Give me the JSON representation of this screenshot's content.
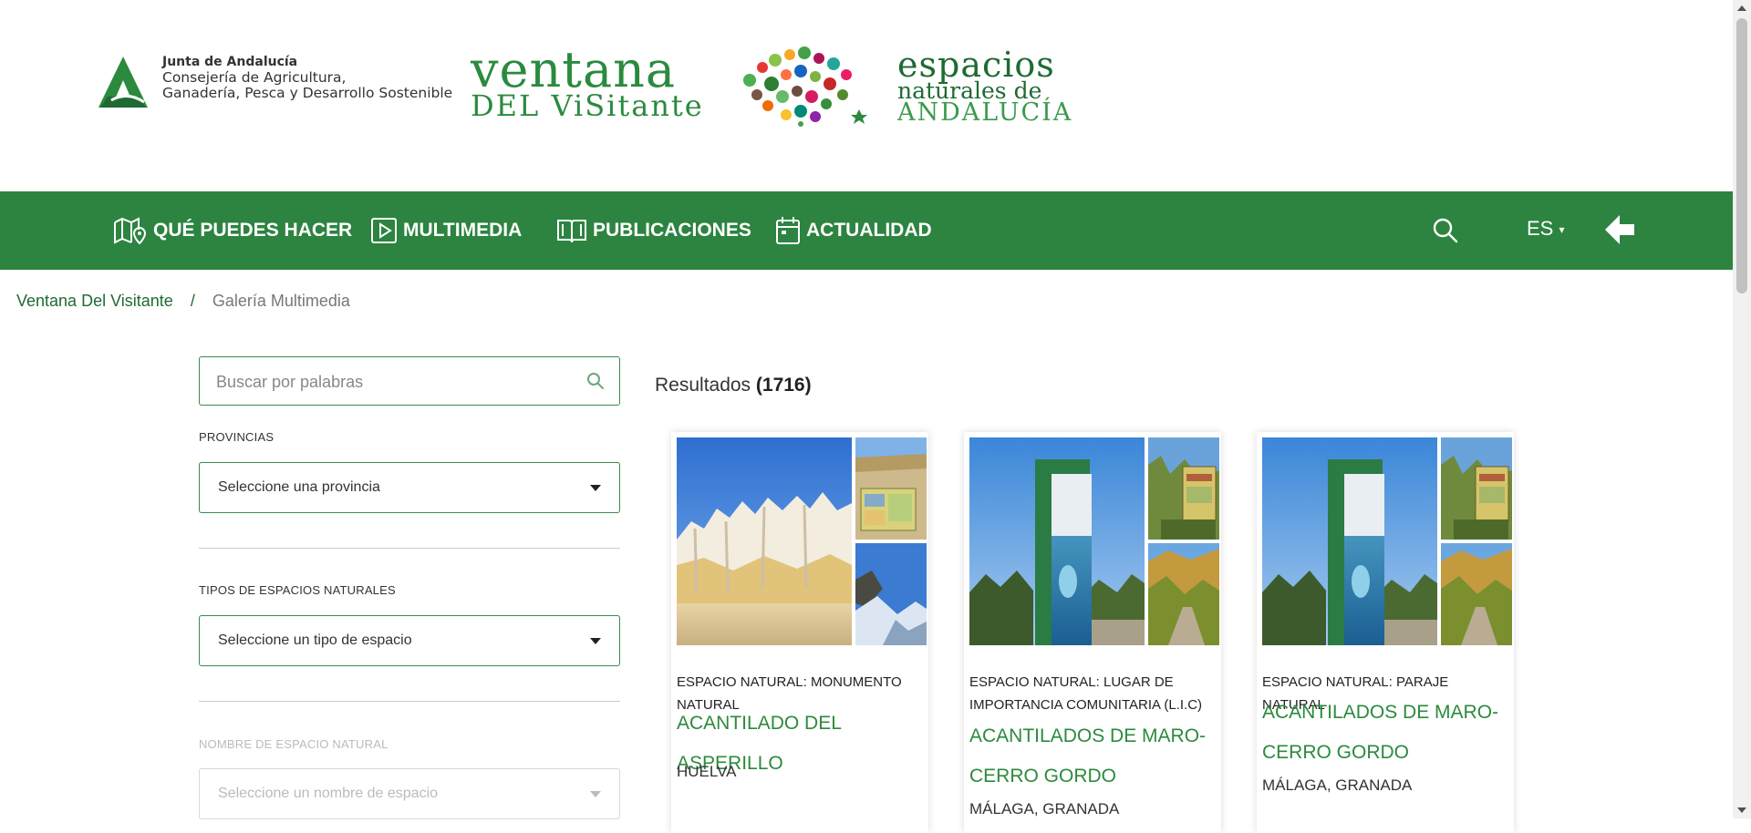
{
  "header": {
    "junta": {
      "line1": "Junta de Andalucía",
      "line2": "Consejería de Agricultura,",
      "line3": "Ganadería, Pesca y Desarrollo Sostenible"
    },
    "ventana_logo": {
      "line1": "ventana",
      "line2": "DEL ViSitante"
    },
    "espacios_logo": {
      "line1": "espacios",
      "line2": "naturales de",
      "line3": "ANDALUCÍA"
    }
  },
  "nav": {
    "items": [
      {
        "label": "QUÉ PUEDES HACER",
        "icon": "map-pin-icon"
      },
      {
        "label": "MULTIMEDIA",
        "icon": "play-icon"
      },
      {
        "label": "PUBLICACIONES",
        "icon": "book-icon"
      },
      {
        "label": "ACTUALIDAD",
        "icon": "calendar-icon"
      }
    ],
    "language": "ES",
    "search_icon": "search-icon",
    "back_icon": "arrow-left-icon"
  },
  "breadcrumb": {
    "home": "Ventana Del Visitante",
    "separator": "/",
    "current": "Galería Multimedia"
  },
  "sidebar": {
    "search_placeholder": "Buscar por palabras",
    "filters": [
      {
        "label": "PROVINCIAS",
        "value": "Seleccione una provincia",
        "enabled": true
      },
      {
        "label": "TIPOS DE ESPACIOS NATURALES",
        "value": "Seleccione un tipo de espacio",
        "enabled": true
      },
      {
        "label": "NOMBRE DE ESPACIO NATURAL",
        "value": "Seleccione un nombre de espacio",
        "enabled": false
      }
    ]
  },
  "results": {
    "label": "Resultados",
    "count": "(1716)",
    "cards": [
      {
        "type": "ESPACIO NATURAL: MONUMENTO NATURAL",
        "title": "ACANTILADO DEL ASPERILLO",
        "provinces": "HUELVA"
      },
      {
        "type": "ESPACIO NATURAL: LUGAR DE IMPORTANCIA COMUNITARIA (L.I.C)",
        "title": "ACANTILADOS DE MARO-CERRO GORDO",
        "provinces": "MÁLAGA, GRANADA"
      },
      {
        "type": "ESPACIO NATURAL: PARAJE NATURAL",
        "title": "ACANTILADOS DE MARO-CERRO GORDO",
        "provinces": "MÁLAGA, GRANADA"
      }
    ]
  },
  "colors": {
    "brand_green": "#2c8440",
    "title_green": "#2c8a3c",
    "link_green": "#1f6a33"
  }
}
